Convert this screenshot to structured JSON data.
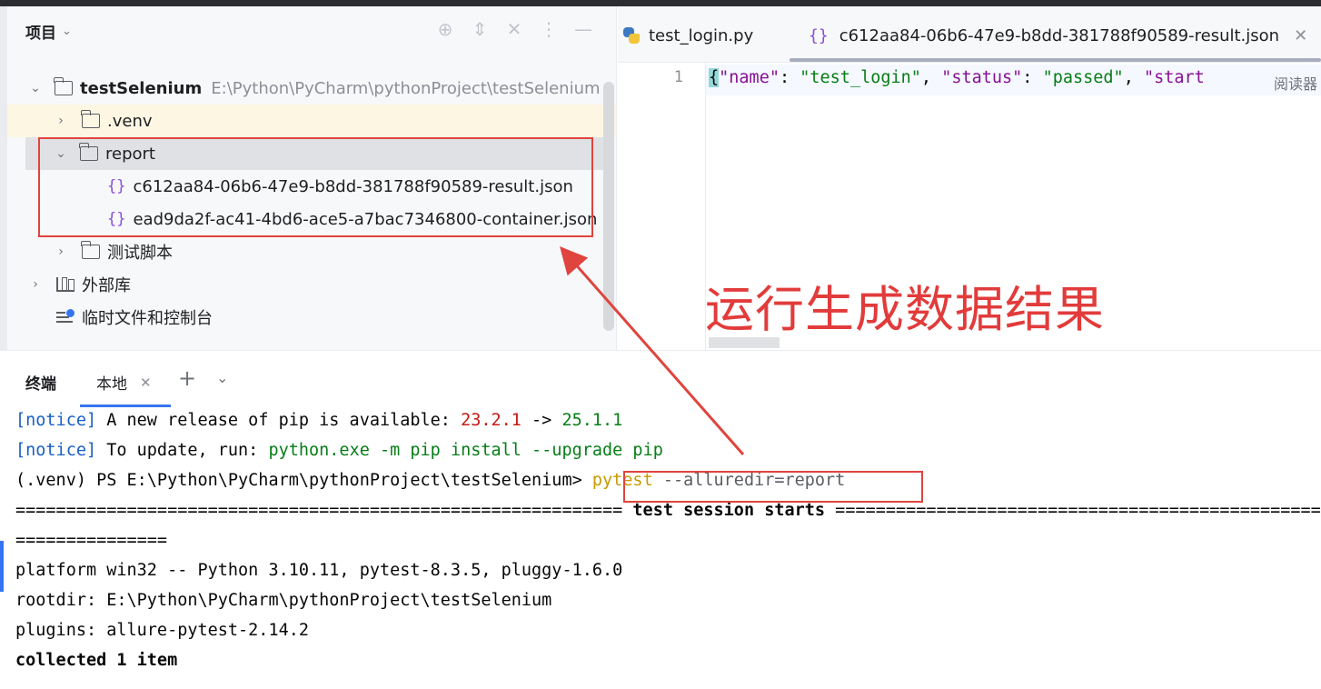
{
  "project": {
    "title": "项目",
    "tree": [
      {
        "label": "testSelenium",
        "path": "E:\\Python\\PyCharm\\pythonProject\\testSelenium"
      },
      {
        "label": ".venv"
      },
      {
        "label": "report"
      },
      {
        "label": "c612aa84-06b6-47e9-b8dd-381788f90589-result.json"
      },
      {
        "label": "ead9da2f-ac41-4bd6-ace5-a7bac7346800-container.json"
      },
      {
        "label": "测试脚本"
      },
      {
        "label": "外部库"
      },
      {
        "label": "临时文件和控制台"
      }
    ]
  },
  "editor": {
    "tabs": [
      {
        "label": "test_login.py"
      },
      {
        "label": "c612aa84-06b6-47e9-b8dd-381788f90589-result.json"
      }
    ],
    "line_number": "1",
    "code": {
      "open": "{",
      "key1": "\"name\"",
      "sep1": ": ",
      "val1": "\"test_login\"",
      "comma1": ", ",
      "key2": "\"status\"",
      "sep2": ": ",
      "val2": "\"passed\"",
      "comma2": ", ",
      "key3": "\"start"
    },
    "reader_mode": "阅读器"
  },
  "annotation": "运行生成数据结果",
  "terminal": {
    "title": "终端",
    "tab": "本地",
    "lines": {
      "l1_notice": "[notice]",
      "l1_text": " A new release of pip is available: ",
      "l1_old": "23.2.1",
      "l1_arrow": " -> ",
      "l1_new": "25.1.1",
      "l2_notice": "[notice]",
      "l2_text": " To update, run: ",
      "l2_cmd": "python.exe -m pip install --upgrade pip",
      "l3_prompt": "(.venv) PS E:\\Python\\PyCharm\\pythonProject\\testSelenium>",
      "l3_cmd": "pytest",
      "l3_args": " --alluredir=report",
      "l4_eq_left": "============================================================ ",
      "l4_text": "test session starts",
      "l4_eq_right": " ============================================================",
      "l5": "===============",
      "l6": "platform win32 -- Python 3.10.11, pytest-8.3.5, pluggy-1.6.0",
      "l7": "rootdir: E:\\Python\\PyCharm\\pythonProject\\testSelenium",
      "l8": "plugins: allure-pytest-2.14.2",
      "l9": "collected 1 item"
    }
  },
  "colors": {
    "annotation_red": "#e23b3b",
    "json_icon": "#8a4fd6",
    "accent_blue": "#3574f0"
  }
}
